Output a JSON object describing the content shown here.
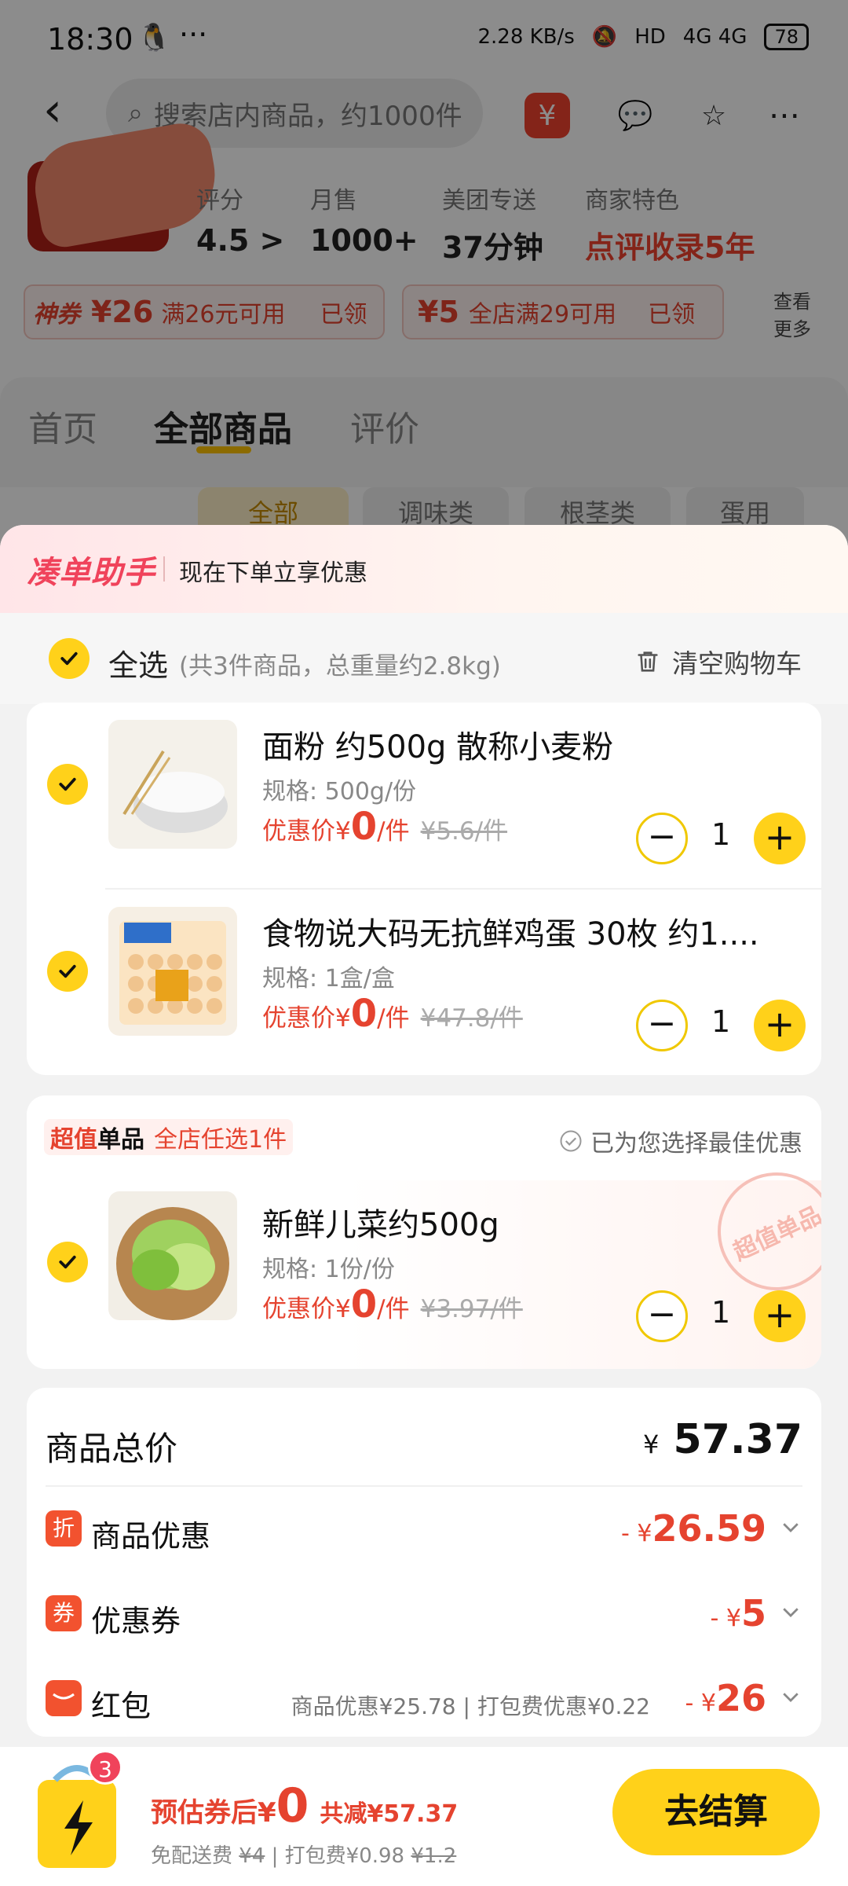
{
  "status_bar": {
    "time": "18:30",
    "extra": "···",
    "net_speed": "2.28 KB/s",
    "hd": "HD",
    "signal": "4G 4G",
    "battery": "78"
  },
  "nav": {
    "search_placeholder": "搜索店内商品，约1000件"
  },
  "shop": {
    "stats": [
      {
        "label": "评分",
        "value": "4.5 >"
      },
      {
        "label": "月售",
        "value": "1000+"
      },
      {
        "label": "美团专送",
        "value": "37分钟"
      },
      {
        "label": "商家特色",
        "value": "点评收录5年"
      }
    ],
    "coupons": [
      {
        "tag": "神券",
        "amount": "¥26",
        "cond": "满26元可用",
        "state": "已领"
      },
      {
        "tag": "",
        "amount": "¥5",
        "cond": "全店满29可用",
        "state": "已领"
      }
    ],
    "more": "查看更多"
  },
  "tabs": [
    "首页",
    "全部商品",
    "评价"
  ],
  "chips": [
    "全部",
    "调味类",
    "根茎类",
    "蛋用"
  ],
  "cart": {
    "helper_brand": "凑单助手",
    "helper_tip": "现在下单立享优惠",
    "select_all": "全选",
    "select_meta": "(共3件商品，总重量约2.8kg)",
    "clear": "清空购物车",
    "price_label": "优惠价",
    "items": [
      {
        "name": "面粉 约500g 散称小麦粉",
        "spec": "规格: 500g/份",
        "currency": "¥",
        "price": "0",
        "unit": "/件",
        "original": "¥5.6/件",
        "qty": "1"
      },
      {
        "name": "食物说大码无抗鲜鸡蛋 30枚 约1....",
        "spec": "规格: 1盒/盒",
        "currency": "¥",
        "price": "0",
        "unit": "/件",
        "original": "¥47.8/件",
        "qty": "1"
      }
    ],
    "promo": {
      "tag_red": "超值",
      "tag_black": "单品",
      "tag_sub": "全店任选1件",
      "best": "已为您选择最佳优惠",
      "stamp": "超值单品",
      "item": {
        "name": "新鲜儿菜约500g",
        "spec": "规格: 1份/份",
        "currency": "¥",
        "price": "0",
        "unit": "/件",
        "original": "¥3.97/件",
        "qty": "1"
      }
    },
    "summary": {
      "total_label": "商品总价",
      "total_currency": "¥",
      "total_value": "57.37",
      "rows": [
        {
          "icon": "折",
          "label": "商品优惠",
          "prefix": "- ¥",
          "value": "26.59",
          "note": ""
        },
        {
          "icon": "券",
          "label": "优惠券",
          "prefix": "- ¥",
          "value": "5",
          "note": ""
        },
        {
          "icon": "",
          "label": "红包",
          "prefix": "- ¥",
          "value": "26",
          "note": "商品优惠¥25.78 | 打包费优惠¥0.22"
        }
      ]
    }
  },
  "bottom": {
    "badge": "3",
    "est_label": "预估券后",
    "est_currency": "¥",
    "est_value": "0",
    "saved": "共减¥57.37",
    "fee_prefix": "免配送费",
    "fee_struck": "¥4",
    "fee_mid": " | 打包费¥0.98",
    "fee_struck2": "¥1.2",
    "checkout": "去结算"
  },
  "colors": {
    "accent_yellow": "#ffd11a",
    "price_red": "#e5432f",
    "brand_pink": "#f0435b"
  }
}
